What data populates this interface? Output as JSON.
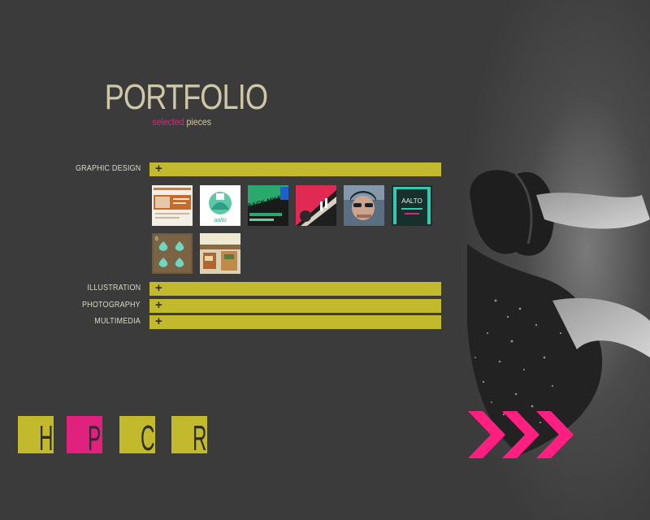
{
  "header": {
    "title": "PORTFOLIO",
    "subtitle_accent": "selected",
    "subtitle_rest": "pieces"
  },
  "sections": [
    {
      "label": "GRAPHIC DESIGN",
      "toggle": "+"
    },
    {
      "label": "ILLUSTRATION",
      "toggle": "+"
    },
    {
      "label": "PHOTOGRAPHY",
      "toggle": "+"
    },
    {
      "label": "MULTIMEDIA",
      "toggle": "+"
    }
  ],
  "thumbnails": [
    {
      "name": "web-layout"
    },
    {
      "name": "aalto-logo-green"
    },
    {
      "name": "back-my-poster",
      "text": "BACK.MY.PI"
    },
    {
      "name": "red-poster"
    },
    {
      "name": "portrait-photo"
    },
    {
      "name": "aalto-logo-teal",
      "text": "AALTO"
    },
    {
      "name": "card-spades"
    },
    {
      "name": "interior-photo"
    }
  ],
  "nav": {
    "letters": [
      "H",
      "P",
      "C",
      "R"
    ],
    "colors": [
      "#c2ba2c",
      "#e0217d",
      "#c2ba2c",
      "#c2ba2c"
    ]
  },
  "next_arrow": {
    "icon": "triple-chevron-right-icon",
    "color": "#ff1f80"
  },
  "colors": {
    "background": "#3b3b3b",
    "accent_yellow": "#c2ba2c",
    "accent_pink": "#e0217d",
    "title_beige": "#cfc8a6"
  }
}
